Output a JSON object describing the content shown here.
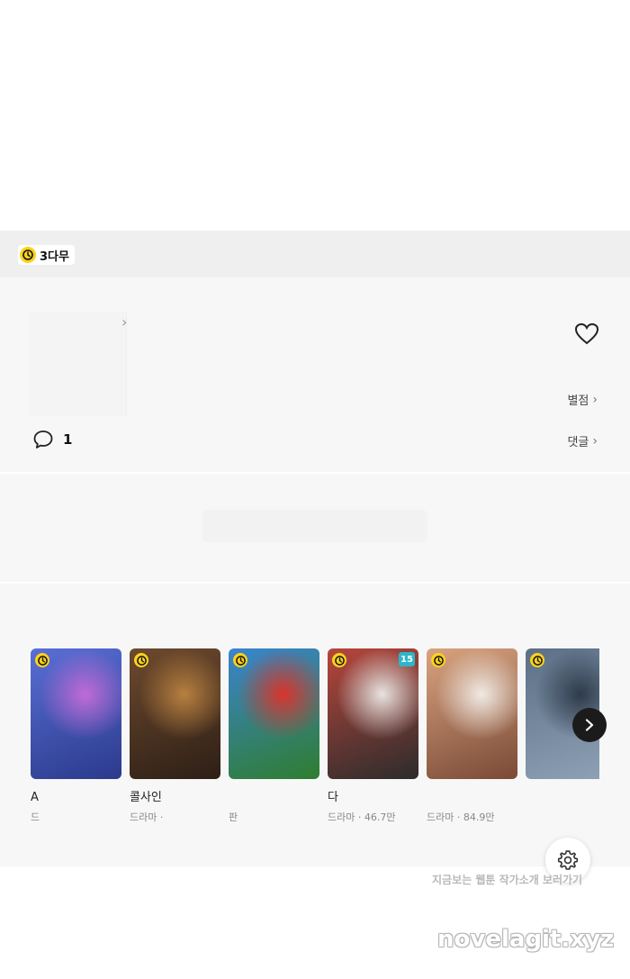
{
  "wait_badge": {
    "label": "3다무",
    "icon": "clock-icon",
    "accent": "#fcd21d"
  },
  "episode_info": {
    "like_icon": "heart-icon",
    "rating_label": "별점",
    "comment_count": "1",
    "comments_label": "댓글"
  },
  "recommendations": {
    "items": [
      {
        "title": "A",
        "meta": "드",
        "colors": [
          "#5a6fd6",
          "#c06bd6",
          "#2b3a8c"
        ],
        "badge": "clock-icon",
        "age": ""
      },
      {
        "title": "콜사인",
        "meta": "드라마 ·",
        "colors": [
          "#6e4a2e",
          "#b7803f",
          "#2d1f16"
        ],
        "badge": "clock-icon",
        "age": ""
      },
      {
        "title": "",
        "meta": "판",
        "colors": [
          "#3a84d0",
          "#d9342b",
          "#2f7d2f"
        ],
        "badge": "clock-icon",
        "age": ""
      },
      {
        "title": "다",
        "meta": "드라마 · 46.7만",
        "colors": [
          "#b7463c",
          "#e8e3e0",
          "#2c2c2c"
        ],
        "badge": "clock-icon",
        "age": "15"
      },
      {
        "title": "",
        "meta": "드라마 · 84.9만",
        "colors": [
          "#d9a380",
          "#f0eae4",
          "#7a4a36"
        ],
        "badge": "clock-icon",
        "age": ""
      },
      {
        "title": "",
        "meta": "",
        "colors": [
          "#5b6f86",
          "#2e3a49",
          "#8fa2b6"
        ],
        "badge": "clock-icon",
        "age": ""
      }
    ],
    "next_icon": "chevron-right-icon"
  },
  "settings_icon": "gear-icon",
  "footer_note": "지금보는 웹툰 작가소개 보러가기",
  "watermark": "novelagit.xyz"
}
